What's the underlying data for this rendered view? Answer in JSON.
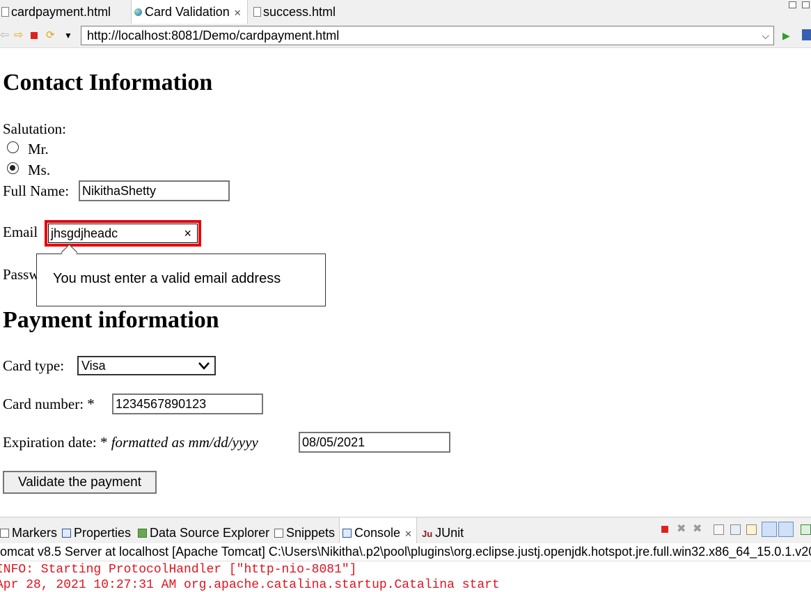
{
  "editor_tabs": [
    {
      "label": "cardpayment.html"
    },
    {
      "label": "Card Validation",
      "close": "✕"
    },
    {
      "label": "success.html"
    }
  ],
  "toolbar": {
    "url": "http://localhost:8081/Demo/cardpayment.html"
  },
  "contact": {
    "heading": "Contact Information",
    "salutation_label": "Salutation:",
    "option_mr": "Mr.",
    "option_ms": "Ms.",
    "selected": "Ms.",
    "fullname_label": "Full Name:",
    "fullname_value": "NikithaShetty",
    "email_label": "Email",
    "email_value": "jhsgdjheadc",
    "email_clear": "×",
    "password_label_partial": "Passw",
    "validation_message": "You must enter a valid email address"
  },
  "payment": {
    "heading": "Payment information",
    "card_type_label": "Card type:",
    "card_type_value": "Visa",
    "card_number_label": "Card number: *",
    "card_number_value": "1234567890123",
    "expiration_label": "Expiration date: *",
    "expiration_hint": "formatted as mm/dd/yyyy",
    "expiration_value": "08/05/2021",
    "validate_button": "Validate the payment"
  },
  "panel": {
    "tabs": [
      {
        "label": "Markers"
      },
      {
        "label": "Properties"
      },
      {
        "label": "Data Source Explorer"
      },
      {
        "label": "Snippets"
      },
      {
        "label": "Console",
        "close": "✕"
      },
      {
        "label": "JUnit"
      }
    ],
    "console_header": "omcat v8.5 Server at localhost [Apache Tomcat] C:\\Users\\Nikitha\\.p2\\pool\\plugins\\org.eclipse.justj.openjdk.hotspot.jre.full.win32.x86_64_15.0.1.v202",
    "console_lines": [
      "INFO: Starting ProtocolHandler [\"http-nio-8081\"]",
      "Apr 28, 2021 10:27:31 AM org.apache.catalina.startup.Catalina start"
    ]
  },
  "colors": {
    "error_outline": "#e8000b",
    "console_text": "#e0141e"
  }
}
